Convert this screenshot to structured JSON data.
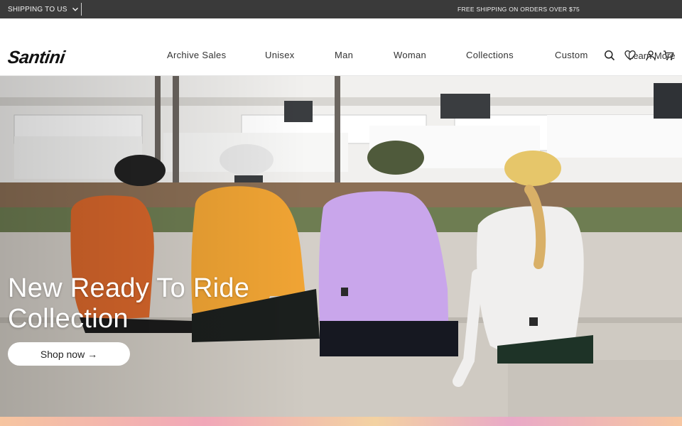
{
  "topbar": {
    "shipping_label": "SHIPPING TO US",
    "promo_text": "FREE SHIPPING ON ORDERS OVER $75"
  },
  "header": {
    "logo_text": "Santini",
    "nav": [
      {
        "label": "Archive Sales"
      },
      {
        "label": "Unisex"
      },
      {
        "label": "Man"
      },
      {
        "label": "Woman"
      },
      {
        "label": "Collections"
      },
      {
        "label": "Custom"
      }
    ],
    "learn_more": "Learn More",
    "icons": [
      "search-icon",
      "wishlist-heart-icon",
      "account-icon",
      "cart-icon"
    ]
  },
  "hero": {
    "title_line1": "New Ready To Ride",
    "title_line2": "Collection",
    "cta_label": "Shop now →"
  },
  "colors": {
    "topbar_bg": "#3a3a3a",
    "header_bg": "#ffffff",
    "cta_bg": "#ffffff"
  }
}
